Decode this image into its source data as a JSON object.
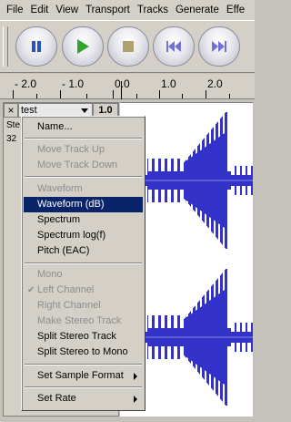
{
  "menubar": {
    "items": [
      "File",
      "Edit",
      "View",
      "Transport",
      "Tracks",
      "Generate",
      "Effe"
    ]
  },
  "toolbar": {
    "buttons": [
      "pause-icon",
      "play-icon",
      "stop-icon",
      "skip-to-start-icon",
      "skip-to-end-icon"
    ],
    "accent_color": "#2a52be"
  },
  "ruler": {
    "labels": [
      "- 2.0",
      "- 1.0",
      "0.0",
      "1.0",
      "2.0"
    ]
  },
  "track": {
    "close_label": "×",
    "name": "test",
    "scale_label": "1.0",
    "info_fragments": [
      "Ste",
      "32"
    ],
    "wave_color": "#3232c8"
  },
  "context_menu": {
    "items": [
      {
        "label": "Name...",
        "enabled": true
      },
      {
        "label": "Move Track Up",
        "enabled": false
      },
      {
        "label": "Move Track Down",
        "enabled": false
      },
      {
        "label": "Waveform",
        "enabled": false
      },
      {
        "label": "Waveform (dB)",
        "enabled": true,
        "selected": true
      },
      {
        "label": "Spectrum",
        "enabled": true
      },
      {
        "label": "Spectrum log(f)",
        "enabled": true
      },
      {
        "label": "Pitch (EAC)",
        "enabled": true
      },
      {
        "label": "Mono",
        "enabled": false
      },
      {
        "label": "Left Channel",
        "enabled": false,
        "checked": true
      },
      {
        "label": "Right Channel",
        "enabled": false
      },
      {
        "label": "Make Stereo Track",
        "enabled": false
      },
      {
        "label": "Split Stereo Track",
        "enabled": true
      },
      {
        "label": "Split Stereo to Mono",
        "enabled": true
      },
      {
        "label": "Set Sample Format",
        "enabled": true,
        "submenu": true
      },
      {
        "label": "Set Rate",
        "enabled": true,
        "submenu": true
      }
    ]
  }
}
